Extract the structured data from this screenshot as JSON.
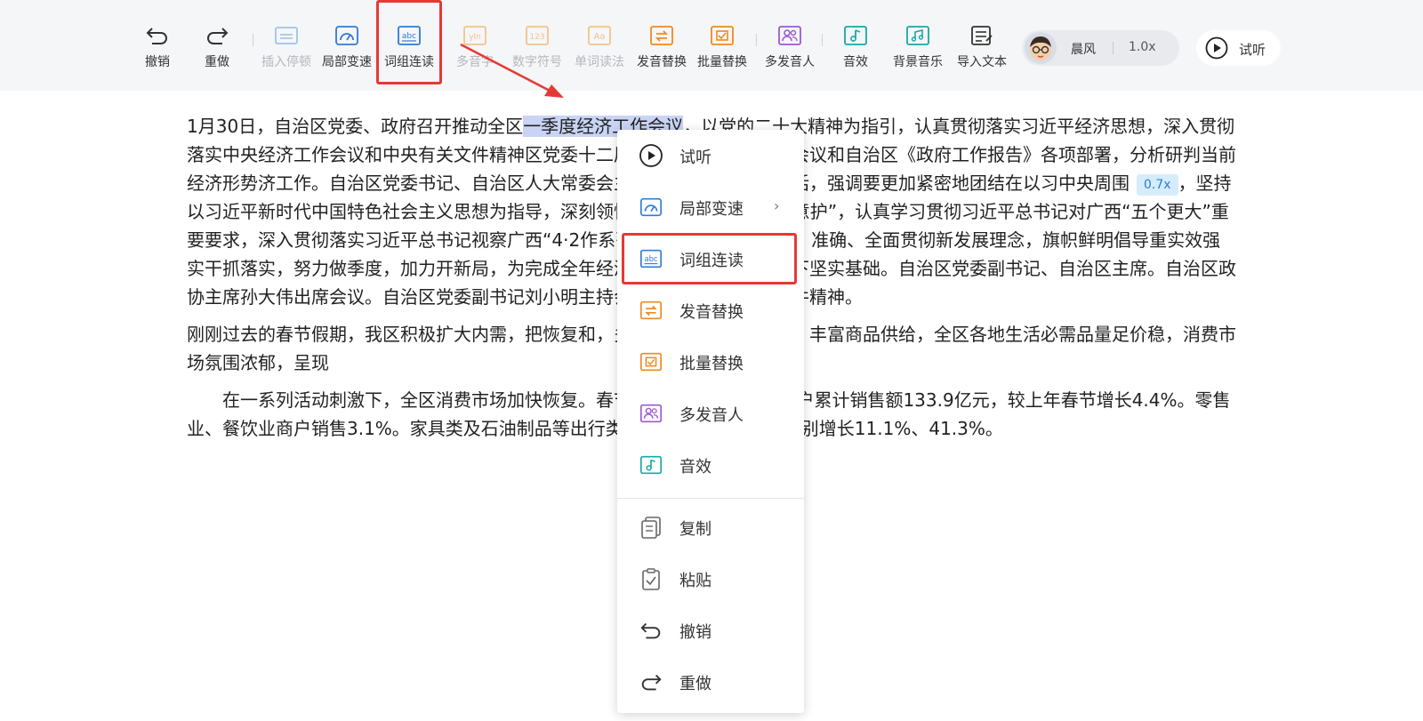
{
  "toolbar": {
    "undo": "撤销",
    "redo": "重做",
    "insert_pause": "插入停顿",
    "local_speed": "局部变速",
    "word_group": "词组连读",
    "polyphone": "多音字",
    "number_symbol": "数字符号",
    "word_reading": "单词读法",
    "pron_replace": "发音替换",
    "batch_replace": "批量替换",
    "multi_speaker": "多发音人",
    "sound_effect": "音效",
    "bg_music": "背景音乐",
    "import_text": "导入文本",
    "voice_name": "晨风",
    "voice_speed": "1.0x",
    "listen": "试听",
    "polyphone_icon_text": "yln",
    "number_icon_text": "123",
    "word_icon_text": "Aa",
    "wordgroup_icon_text": "abc"
  },
  "content": {
    "p1_a": "1月30日，自治区党委、政府召开推动全区",
    "p1_sel": "一季度经济工作会议",
    "p1_b": "，以党的二十大精神为指引，认真贯彻落实习近平经济思想，深入贯彻落实中央经济工作会议和中央有关文件精神",
    "p1_c": "区党委十二届五次全会暨经济工作会议和自治区《政府工作报告》各项部署，分析研判当前经济形势",
    "p1_d": "济工作。自治区党委书记、自治区人大常委会主任刘宁出席会议并讲话，强调要更加紧密地团结在以习",
    "p1_e": "中央周围",
    "p1_speed": "0.7x",
    "p1_f": "，坚持以习近平新时代中国特色社会主义思想为指导，深刻领悟“两个确立”的决定性意",
    "p1_g": "护”，认真学习贯彻习近平总书记对广西“五个更大”重要要求，深入贯彻落实习近平总书记视察广西“4·2",
    "p1_h": "作系列重要指示精神，完整、准确、全面贯彻新发展理念，旗帜鲜明倡导重实效强实干抓落实，努力做",
    "p1_i": "季度，加力开新局，为完成全年经济社会发展目标任务打下坚实基础。自治区党委副书记、自治区主席",
    "p1_j": "。自治区政协主席孙大伟出席会议。自治区党委副书记刘小明主持会议并传达中央有关文件精神。",
    "p2_a": "刚刚过去的春节假期，我区积极扩大内需，把恢复和",
    "p2_b": "，多措并举活跃假日市场，丰富商品供给，全区各地生活必需品量足价稳，消费市场氛围浓郁，呈现",
    "p3_a": "在一系列活动刺激下，全区消费市场加快恢复。",
    "p3_b": "春节期间，全区60万户商户累计销售额133.9亿元，较上年春节增长4.4%。零售业、餐饮业商户销售",
    "p3_c": "3.1%。家具类及石油制品等出行类商品销售旺盛，同比分别增长11.1%、41.3%。"
  },
  "context_menu": {
    "listen": "试听",
    "local_speed": "局部变速",
    "word_group": "词组连读",
    "pron_replace": "发音替换",
    "batch_replace": "批量替换",
    "multi_speaker": "多发音人",
    "sound_effect": "音效",
    "copy": "复制",
    "paste": "粘贴",
    "undo": "撤销",
    "redo": "重做",
    "submenu_chevron": "›"
  },
  "colors": {
    "accent_red": "#e53935",
    "icon_blue": "#2f7bd8",
    "icon_orange": "#ef8a1f",
    "icon_purple": "#9b59d6",
    "icon_teal": "#17a9a4",
    "disabled": "#b4b7bd",
    "selection": "#c9d4f4"
  },
  "icons": [
    "undo-icon",
    "redo-icon",
    "pause-icon",
    "speedometer-icon",
    "abc-icon",
    "yln-icon",
    "123-icon",
    "aa-icon",
    "swap-icon",
    "batch-icon",
    "people-icon",
    "music-note-icon",
    "music-icon",
    "import-text-icon",
    "play-icon",
    "copy-icon",
    "paste-icon",
    "chevron-right-icon"
  ]
}
